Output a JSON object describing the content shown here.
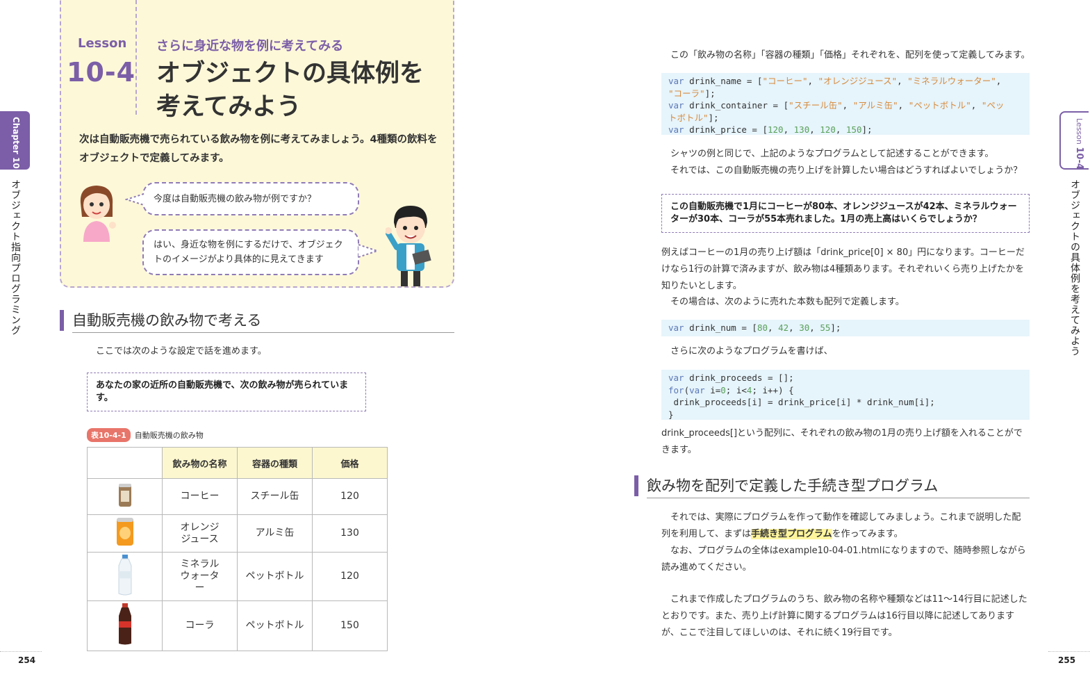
{
  "left_page": {
    "chapter_tab": "Chapter 10",
    "chapter_title": "オブジェクト指向プログラミング",
    "lesson_label": "Lesson",
    "lesson_number": "10-4",
    "subtitle": "さらに身近な物を例に考えてみる",
    "title_line1": "オブジェクトの具体例を",
    "title_line2": "考えてみよう",
    "intro": "次は自動販売機で売られている飲み物を例に考えてみましょう。4種類の飲料をオブジェクトで定義してみます。",
    "bubble1": "今度は自動販売機の飲み物が例ですか？",
    "bubble2": "はい、身近な物を例にするだけで、オブジェクトのイメージがより具体的に見えてきます",
    "section_heading": "自動販売機の飲み物で考える",
    "setup_text": "ここでは次のような設定で話を進めます。",
    "callout": "あなたの家の近所の自動販売機で、次の飲み物が売られています。",
    "table_badge": "表10-4-1",
    "table_caption": "自動販売機の飲み物",
    "table_headers": [
      "飲み物の名称",
      "容器の種類",
      "価格"
    ],
    "table_rows": [
      {
        "name": "コーヒー",
        "container": "スチール缶",
        "price": "120",
        "icon": "coffee-can-icon"
      },
      {
        "name": "オレンジジュース",
        "container": "アルミ缶",
        "price": "130",
        "icon": "orange-juice-can-icon"
      },
      {
        "name": "ミネラルウォーター",
        "container": "ペットボトル",
        "price": "120",
        "icon": "water-bottle-icon"
      },
      {
        "name": "コーラ",
        "container": "ペットボトル",
        "price": "150",
        "icon": "cola-bottle-icon"
      }
    ],
    "page_number": "254"
  },
  "right_page": {
    "lesson_tab_label": "Lesson",
    "lesson_tab_number": "10-4",
    "side_title": "オブジェクトの具体例を考えてみよう",
    "p1": "この「飲み物の名称」「容器の種類」「価格」それぞれを、配列を使って定義してみます。",
    "p2a": "シャツの例と同じで、上記のようなプログラムとして記述することができます。",
    "p2b": "それでは、この自動販売機の売り上げを計算したい場合はどうすればよいでしょうか？",
    "callout": "この自動販売機で1月にコーヒーが80本、オレンジジュースが42本、ミネラルウォーターが30本、コーラが55本売れました。1月の売上高はいくらでしょうか？",
    "p3": "例えばコーヒーの1月の売り上げ額は「drink_price[0] × 80」円になります。コーヒーだけなら1行の計算で済みますが、飲み物は4種類あります。それぞれいくら売り上げたかを知りたいとします。",
    "p4": "その場合は、次のように売れた本数も配列で定義します。",
    "p5": "さらに次のようなプログラムを書けば、",
    "p6": "drink_proceeds[]という配列に、それぞれの飲み物の1月の売り上げ額を入れることができます。",
    "section_heading": "飲み物を配列で定義した手続き型プログラム",
    "p7_before": "それでは、実際にプログラムを作って動作を確認してみましょう。これまで説明した配列を利用して、まずは",
    "p7_highlight": "手続き型プログラム",
    "p7_after": "を作ってみます。",
    "p8": "なお、プログラムの全体はexample10-04-01.htmlになりますので、随時参照しながら読み進めてください。",
    "p9": "これまで作成したプログラムのうち、飲み物の名称や種類などは11～14行目に記述したとおりです。また、売り上げ計算に関するプログラムは16行目以降に記述してありますが、ここで注目してほしいのは、それに続く19行目です。",
    "page_number": "255"
  },
  "colors": {
    "accent_purple": "#7b5ea7",
    "header_bg": "#fdf8d8",
    "code_bg": "#e6f4fb",
    "badge_red": "#e8756a"
  }
}
